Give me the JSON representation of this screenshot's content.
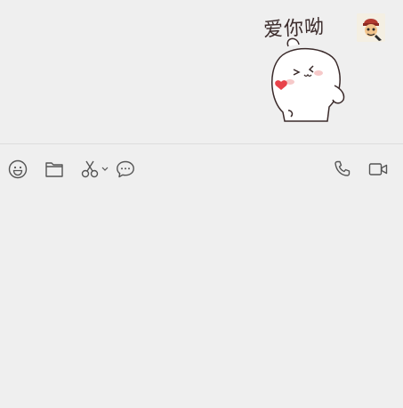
{
  "chat": {
    "sticker_caption": "爱你呦"
  },
  "toolbar": {
    "left_icons": [
      "emoji-icon",
      "folder-icon",
      "scissors-icon",
      "chevron-down-icon",
      "chat-bubble-icon"
    ],
    "right_icons": [
      "phone-icon",
      "video-camera-icon"
    ]
  },
  "colors": {
    "background": "#efefef",
    "icon_stroke": "#555555",
    "divider": "#dcdcdc",
    "heart": "#e8434b"
  }
}
